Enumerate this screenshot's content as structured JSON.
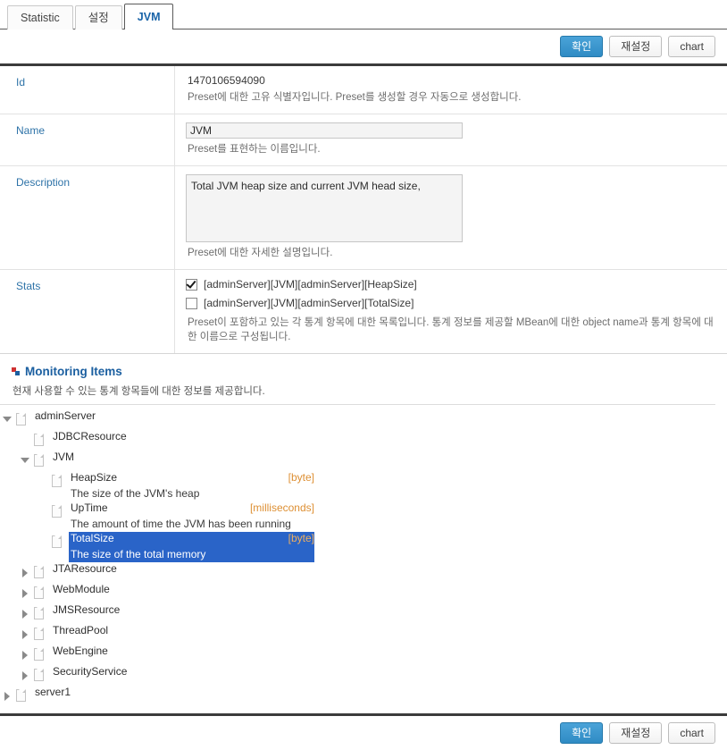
{
  "tabs": [
    {
      "label": "Statistic",
      "active": false
    },
    {
      "label": "설정",
      "active": false
    },
    {
      "label": "JVM",
      "active": true
    }
  ],
  "buttons": {
    "confirm": "확인",
    "reset": "재설정",
    "chart": "chart"
  },
  "form": {
    "id": {
      "label": "Id",
      "value": "1470106594090",
      "hint": "Preset에 대한 고유 식별자입니다. Preset를 생성할 경우 자동으로 생성합니다."
    },
    "name": {
      "label": "Name",
      "value": "JVM",
      "placeholder": "",
      "hint": "Preset를 표현하는 이름입니다."
    },
    "description": {
      "label": "Description",
      "value": "Total JVM heap size and current JVM head size,",
      "placeholder": "",
      "hint": "Preset에 대한 자세한 설명입니다."
    },
    "stats": {
      "label": "Stats",
      "items": [
        {
          "label": "[adminServer][JVM][adminServer][HeapSize]",
          "checked": true
        },
        {
          "label": "[adminServer][JVM][adminServer][TotalSize]",
          "checked": false
        }
      ],
      "hint": "Preset이 포함하고 있는 각 통계 항목에 대한 목록입니다. 통계 정보를 제공할 MBean에 대한 object name과 통계 항목에 대한 이름으로 구성됩니다."
    }
  },
  "monitoring": {
    "title": "Monitoring Items",
    "icon": "blue-red-squares-icon",
    "description": "현재 사용할 수 있는 통계 항목들에 대한 정보를 제공합니다.",
    "tree": [
      {
        "name": "adminServer",
        "expanded": true,
        "children": [
          {
            "name": "JDBCResource",
            "expanded": null
          },
          {
            "name": "JVM",
            "expanded": true,
            "children": [
              {
                "name": "HeapSize",
                "unit": "[byte]",
                "desc": "The size of the JVM's heap",
                "selected": false
              },
              {
                "name": "UpTime",
                "unit": "[milliseconds]",
                "desc": "The amount of time the JVM has been running",
                "selected": false
              },
              {
                "name": "TotalSize",
                "unit": "[byte]",
                "desc": "The size of the total memory",
                "selected": true
              }
            ]
          },
          {
            "name": "JTAResource",
            "expanded": false
          },
          {
            "name": "WebModule",
            "expanded": false
          },
          {
            "name": "JMSResource",
            "expanded": false
          },
          {
            "name": "ThreadPool",
            "expanded": false
          },
          {
            "name": "WebEngine",
            "expanded": false
          },
          {
            "name": "SecurityService",
            "expanded": false
          }
        ]
      },
      {
        "name": "server1",
        "expanded": false
      }
    ]
  },
  "colors": {
    "accent": "#1b5fa0",
    "primary_button": "#2f8bc4",
    "selection": "#2a64c8",
    "unit_text": "#dd8f33",
    "label_text": "#2e73a8"
  }
}
